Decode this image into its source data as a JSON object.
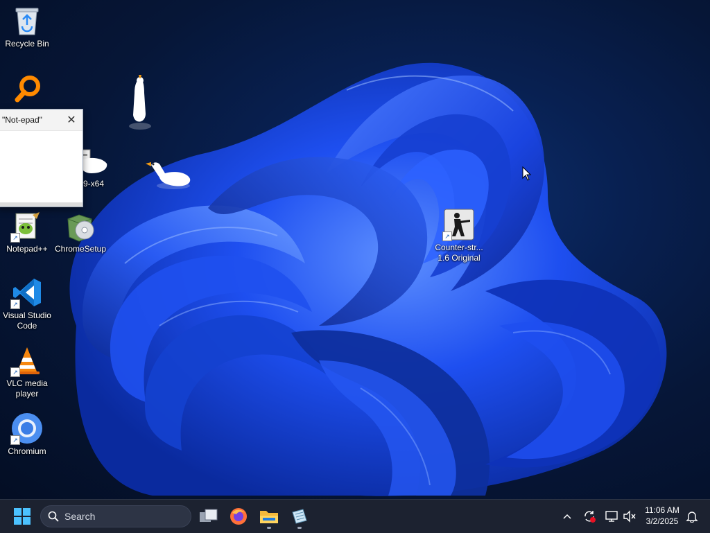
{
  "desktop": {
    "icons": [
      {
        "name": "recycle-bin-icon",
        "label": "Recycle Bin"
      },
      {
        "name": "notepadpp-icon",
        "label": "Notepad++"
      },
      {
        "name": "chromesetup-icon",
        "label": "ChromeSetup"
      },
      {
        "name": "vscode-icon",
        "label": "Visual Studio\nCode"
      },
      {
        "name": "vlc-icon",
        "label": "VLC media\nplayer"
      },
      {
        "name": "chromium-icon",
        "label": "Chromium"
      },
      {
        "name": "counter-strike-icon",
        "label": "Counter-str...\n1.6 Original"
      }
    ],
    "partial_label": "9-x64"
  },
  "window": {
    "title": "\"Not-epad\"",
    "close_glyph": "✕"
  },
  "taskbar": {
    "search_placeholder": "Search",
    "apps": [
      "start-button",
      "task-view",
      "firefox",
      "file-explorer",
      "notepad-app"
    ],
    "clock_time": "11:06 AM",
    "clock_date": "3/2/2025"
  },
  "colors": {
    "taskbar_bg": "#1c2230",
    "wallpaper_blue": "#1f4fe0",
    "accent": "#2a8af5"
  }
}
